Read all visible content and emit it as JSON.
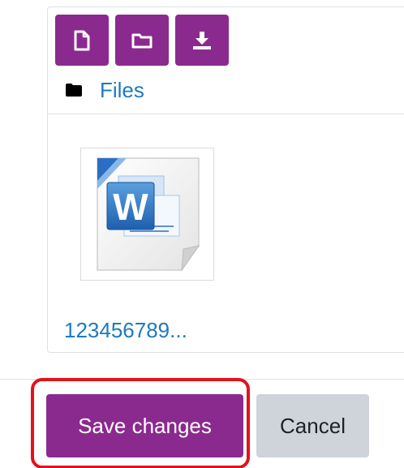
{
  "filemanager": {
    "toolbar": {
      "buttons": [
        {
          "icon": "add-file-icon"
        },
        {
          "icon": "create-folder-icon"
        },
        {
          "icon": "download-icon"
        }
      ],
      "accent_color": "#8b2a8e"
    },
    "breadcrumb": {
      "icon": "folder-icon",
      "label": "Files"
    },
    "files": [
      {
        "name": "123456789...",
        "icon": "word-document-icon"
      }
    ]
  },
  "actions": {
    "save_label": "Save changes",
    "cancel_label": "Cancel",
    "highlight_color": "#e3121b"
  },
  "colors": {
    "link": "#1e7ac0",
    "primary": "#8b2a8e",
    "secondary": "#ced4da"
  }
}
